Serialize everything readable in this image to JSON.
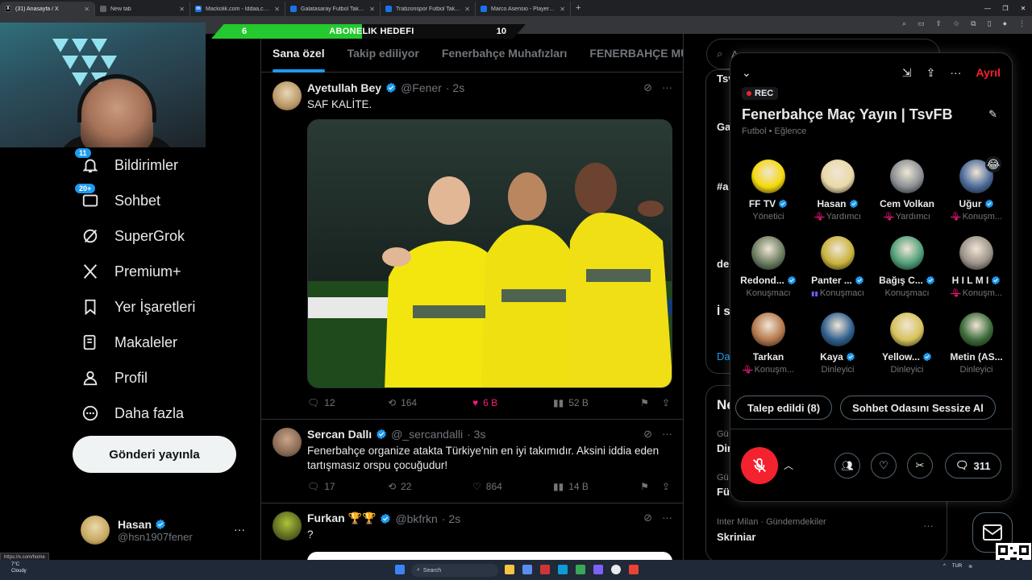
{
  "browser": {
    "tabs": [
      {
        "title": "(31) Anasayfa / X",
        "active": true,
        "favicon": "x-icon",
        "color": "#000000"
      },
      {
        "title": "New tab",
        "active": false,
        "favicon": "chrome-icon",
        "color": "#5f6368"
      },
      {
        "title": "Mackolik.com - İddaa,canlı ma...",
        "active": false,
        "favicon": "m-icon",
        "color": "#1a73e8"
      },
      {
        "title": "Galatasaray Futbol Takımı - 20...",
        "active": false,
        "favicon": "tm-icon",
        "color": "#1a73e8"
      },
      {
        "title": "Trabzonspor Futbol Takımı - 20...",
        "active": false,
        "favicon": "tm-icon",
        "color": "#1a73e8"
      },
      {
        "title": "Marco Asensio - Player profile ...",
        "active": false,
        "favicon": "tm-icon",
        "color": "#1a73e8"
      }
    ],
    "status_link": "https://x.com/home"
  },
  "goal_bar": {
    "left": "6",
    "label": "ABONELIK HEDEFI",
    "right": "10",
    "progress": 0.48
  },
  "sidebar": {
    "items": [
      {
        "label": "Bildirimler",
        "icon": "bell-icon",
        "badge": "11"
      },
      {
        "label": "Sohbet",
        "icon": "mail-icon",
        "badge": "20+"
      },
      {
        "label": "SuperGrok",
        "icon": "grok-icon",
        "badge": ""
      },
      {
        "label": "Premium+",
        "icon": "x-logo-icon",
        "badge": ""
      },
      {
        "label": "Yer İşaretleri",
        "icon": "bookmark-icon",
        "badge": ""
      },
      {
        "label": "Makaleler",
        "icon": "article-icon",
        "badge": ""
      },
      {
        "label": "Profil",
        "icon": "person-icon",
        "badge": ""
      },
      {
        "label": "Daha fazla",
        "icon": "more-circle-icon",
        "badge": ""
      }
    ],
    "post_button": "Gönderi yayınla",
    "profile": {
      "name": "Hasan",
      "handle": "@hsn1907fener",
      "more": "···"
    }
  },
  "feed": {
    "tabs": [
      "Sana özel",
      "Takip ediliyor",
      "Fenerbahçe Muhafızları",
      "FENERBAHÇE MÜCADİ"
    ],
    "active_tab": 0,
    "tweets": [
      {
        "name": "Ayetullah Bey",
        "handle": "@Fener",
        "time": "· 2s",
        "text": "SAF KALİTE.",
        "replies": "12",
        "retweets": "164",
        "likes": "6 B",
        "views": "52 B",
        "liked": true
      },
      {
        "name": "Sercan Dallı",
        "handle": "@_sercandalli",
        "time": "· 3s",
        "text": "Fenerbahçe organize atakta Türkiye'nin en iyi takımıdır. Aksini iddia eden tartışmasız orspu çocuğudur!",
        "replies": "17",
        "retweets": "22",
        "likes": "864",
        "views": "14 B",
        "liked": false
      },
      {
        "name": "Furkan 🏆🏆",
        "handle": "@bkfrkn",
        "time": "· 2s",
        "text": "?",
        "replies": "",
        "retweets": "",
        "likes": "",
        "views": "",
        "liked": false
      }
    ]
  },
  "right_column": {
    "search_placeholder": "A",
    "trend_fragments": [
      "Tsv",
      "Ga",
      "#a",
      "de",
      "İ s",
      "Da"
    ],
    "news_header": "Ne",
    "news_fragments": [
      "Gü",
      "Dir",
      "Gü",
      "Fü"
    ],
    "trend": {
      "context": "Inter Milan · Gündemdekiler",
      "title": "Skriniar"
    }
  },
  "space": {
    "leave": "Ayrıl",
    "rec": "REC",
    "title": "Fenerbahçe Maç Yayın | TsvFB",
    "category": "Futbol • Eğlence",
    "speakers": [
      {
        "name": "FF TV",
        "role": "Yönetici",
        "verified": true,
        "muted": false,
        "color": "#f5d90a"
      },
      {
        "name": "Hasan",
        "role": "Yardımcı",
        "verified": true,
        "muted": true,
        "color": "#e9d9a8"
      },
      {
        "name": "Cem Volkan",
        "role": "Yardımcı",
        "verified": false,
        "muted": true,
        "color": "#8a8f94"
      },
      {
        "name": "Uğur",
        "role": "Konuşm...",
        "verified": true,
        "muted": true,
        "color": "#4b6a9b",
        "emoji": "😂"
      },
      {
        "name": "Redond...",
        "role": "Konuşmacı",
        "verified": true,
        "muted": false,
        "color": "#6b7d61"
      },
      {
        "name": "Panter ...",
        "role": "Konuşmacı",
        "verified": true,
        "muted": false,
        "speaking": true,
        "color": "#c9b23c"
      },
      {
        "name": "Bağış C...",
        "role": "Konuşmacı",
        "verified": true,
        "muted": false,
        "color": "#4f9e78"
      },
      {
        "name": "H I L M I",
        "role": "Konuşm...",
        "verified": true,
        "muted": true,
        "color": "#9b9289"
      },
      {
        "name": "Tarkan",
        "role": "Konuşm...",
        "verified": false,
        "muted": true,
        "color": "#b5784d"
      },
      {
        "name": "Kaya",
        "role": "Dinleyici",
        "verified": true,
        "muted": false,
        "color": "#2f5f8f"
      },
      {
        "name": "Yellow...",
        "role": "Dinleyici",
        "verified": true,
        "muted": false,
        "color": "#d6c25a"
      },
      {
        "name": "Metin (AS...",
        "role": "Dinleyici",
        "verified": false,
        "muted": false,
        "color": "#3c6b3a"
      }
    ],
    "requests_button": "Talep edildi (8)",
    "mute_room_button": "Sohbet Odasını Sessize Al",
    "comment_count": "311"
  },
  "taskbar": {
    "weather_temp": "7°C",
    "weather_desc": "Cloudy",
    "search": "Search",
    "lang": "TUR"
  },
  "colors": {
    "accent": "#1d9bf0",
    "like": "#f91880",
    "leave": "#f4212e",
    "goal_green": "#23c92e"
  }
}
